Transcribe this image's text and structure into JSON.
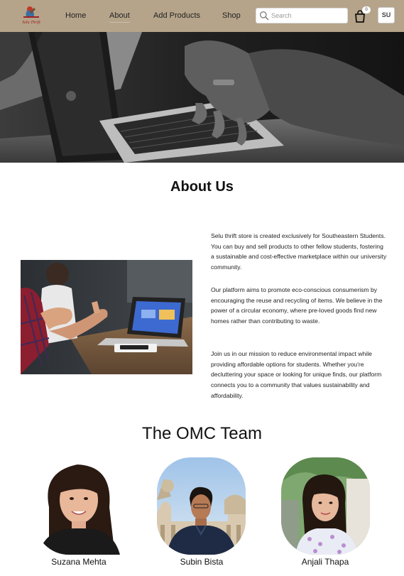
{
  "logo": {
    "text": "Selu Thrift"
  },
  "nav": {
    "links": [
      "Home",
      "About",
      "Add Products",
      "Shop"
    ],
    "active": "About"
  },
  "search": {
    "placeholder": "Search",
    "value": ""
  },
  "cart": {
    "count": "0"
  },
  "user": {
    "initials": "SU"
  },
  "about": {
    "title": "About Us",
    "paragraphs": [
      "Selu thrift store is created exclusively for Southeastern Students. You can buy and sell products to other fellow students, fostering a sustainable and cost-effective marketplace within our university community.",
      "Our platform aims to promote eco-conscious consumerism by encouraging the reuse and recycling of items. We believe in the power of a circular economy, where pre-loved goods find new homes rather than contributing to waste.",
      "Join us in our mission to reduce environmental impact while providing affordable options for students. Whether you're decluttering your space or looking for unique finds, our platform connects you to a community that values sustainability and affordability."
    ]
  },
  "team": {
    "title": "The OMC Team",
    "members": [
      {
        "name": "Suzana Mehta"
      },
      {
        "name": "Subin Bista"
      },
      {
        "name": "Anjali Thapa"
      }
    ]
  },
  "colors": {
    "navbar": "#b5a48a",
    "background": "#ffffff",
    "text": "#111111"
  }
}
